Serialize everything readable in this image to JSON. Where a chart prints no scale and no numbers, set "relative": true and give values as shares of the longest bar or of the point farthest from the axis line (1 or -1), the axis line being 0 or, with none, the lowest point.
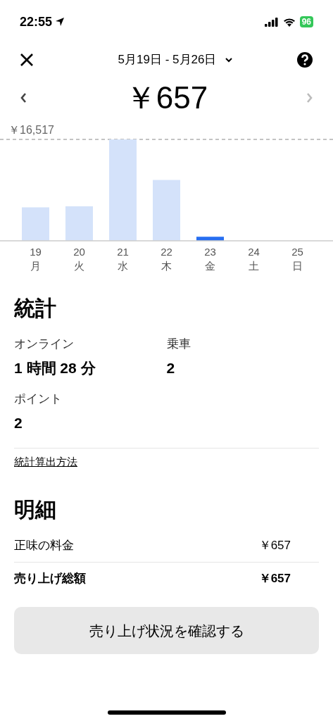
{
  "status_bar": {
    "time": "22:55",
    "battery": "96"
  },
  "header": {
    "date_range": "5月19日 - 5月26日"
  },
  "total": {
    "amount": "￥657",
    "prev_enabled": true,
    "next_enabled": false
  },
  "chart": {
    "chart_data": {
      "type": "bar",
      "categories": [
        "19",
        "20",
        "21",
        "22",
        "23",
        "24",
        "25"
      ],
      "series": [
        {
          "color": "#d4e2fa",
          "values": [
            0.33,
            0.34,
            1,
            0.6,
            null,
            0,
            0
          ]
        },
        {
          "color": "#276ef1",
          "values": [
            null,
            null,
            null,
            null,
            0.04,
            null,
            null
          ]
        }
      ],
      "relative": true,
      "annotations": [
        "￥16,517"
      ]
    },
    "weekdays": [
      "月",
      "火",
      "水",
      "木",
      "金",
      "土",
      "日"
    ]
  },
  "stats": {
    "title": "統計",
    "items": [
      {
        "label": "オンライン",
        "value": "1 時間 28 分"
      },
      {
        "label": "乗車",
        "value": "2"
      },
      {
        "label": "ポイント",
        "value": "2"
      }
    ],
    "link": "統計算出方法"
  },
  "details": {
    "title": "明細",
    "rows": [
      {
        "label": "正味の料金",
        "value": "￥657",
        "bold": false
      },
      {
        "label": "売り上げ総額",
        "value": "￥657",
        "bold": true
      }
    ]
  },
  "button": "売り上げ状況を確認する"
}
